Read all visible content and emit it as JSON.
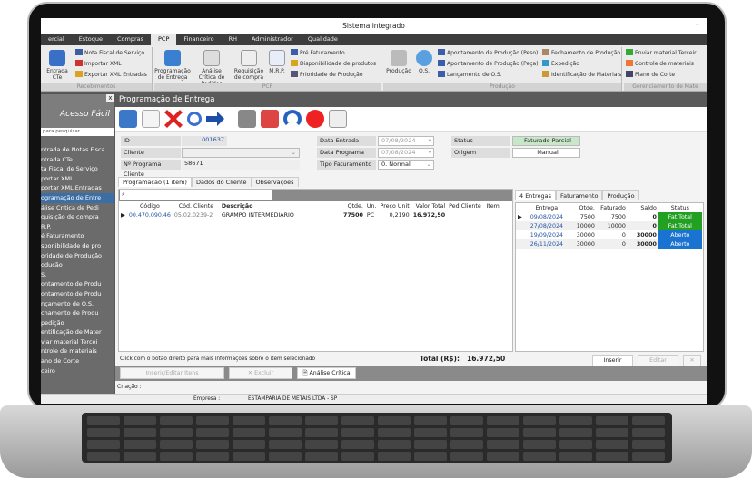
{
  "window_title": "Sistema integrado",
  "menu": [
    "ercial",
    "Estoque",
    "Compras",
    "PCP",
    "Financeiro",
    "RH",
    "Administrador",
    "Qualidade"
  ],
  "menu_active": "PCP",
  "ribbon": {
    "recebimentos": {
      "label": "Recebimentos",
      "big": "Entrada CTe",
      "items": [
        "Nota Fiscal de Serviço",
        "Importar XML",
        "Exportar XML Entradas"
      ]
    },
    "pcp": {
      "label": "PCP",
      "big": [
        "Programação de Entrega",
        "Análise Crítica de Pedidos",
        "Requisição de compra",
        "M.R.P."
      ],
      "items": [
        "Pré Faturamento",
        "Disponibilidade de produtos",
        "Prioridade de Produção"
      ]
    },
    "producao": {
      "label": "Produção",
      "big": [
        "Produção",
        "O.S."
      ],
      "items": [
        "Apontamento de Produção (Peso)",
        "Apontamento de Produção (Peça)",
        "Lançamento de O.S.",
        "Fechamento de Produção",
        "Expedição",
        "Identificação de Materiais"
      ]
    },
    "materiais": {
      "label": "Gerenciamento de Mate",
      "items": [
        "Enviar material Terceir",
        "Controle de materiais",
        "Plano de Corte"
      ]
    }
  },
  "left_panel": {
    "title": "Acesso Fácil",
    "search_placeholder": "para pesquisar",
    "items": [
      "ntrada de Notas Fisca",
      "ntrada CTe",
      "ta Fiscal de Serviço",
      "portar XML",
      "portar XML Entradas",
      "ogramação de Entre",
      "álise Crítica de Pedi",
      "quisição de compra",
      "R.P.",
      "é Faturamento",
      "sponibilidade de pro",
      "oridade de Produção",
      "odução",
      "S.",
      "ontamento de Produ",
      "ontamento de Produ",
      "nçamento de O.S.",
      "chamento de Produ",
      "pedição",
      "entificação de Mater",
      "viar material Tercei",
      "ntrole de materiais",
      "ano de Corte",
      "ceiro"
    ],
    "selected": 5
  },
  "form": {
    "title": "Programação de Entrega",
    "id_label": "ID",
    "id": "001637",
    "cliente_label": "Cliente",
    "cliente": "",
    "nprog_label": "Nº Programa Cliente",
    "nprog": "58671",
    "data_entrada_label": "Data Entrada",
    "data_entrada": "07/08/2024",
    "data_programa_label": "Data Programa",
    "data_programa": "07/08/2024",
    "tipo_label": "Tipo Faturamento",
    "tipo": "0. Normal",
    "status_label": "Status",
    "status": "Faturado Parcial",
    "origem_label": "Origem",
    "origem": "Manual"
  },
  "tabs": [
    "Programação (1 item)",
    "Dados do Cliente",
    "Observações"
  ],
  "items_grid": {
    "columns": [
      "Código",
      "Cód. Cliente",
      "Descrição",
      "Qtde.",
      "Un.",
      "Preço Unit",
      "Valor Total",
      "Ped.Cliente",
      "Item"
    ],
    "rows": [
      [
        "00.470.090.46",
        "05.02.0239-2",
        "GRAMPO INTERMEDIARIO",
        "77500",
        "PC",
        "0,2190",
        "16.972,50",
        "",
        ""
      ]
    ]
  },
  "hint": "Click com o botão direito para mais informações sobre o item selecionado",
  "total_label": "Total (R$):",
  "total": "16.972,50",
  "entregas_tabs": [
    "4 Entregas",
    "Faturamento",
    "Produção"
  ],
  "entregas": {
    "columns": [
      "Entrega",
      "Qtde.",
      "Faturado",
      "Saldo",
      "Status"
    ],
    "rows": [
      [
        "09/08/2024",
        "7500",
        "7500",
        "0",
        "Fat.Total"
      ],
      [
        "27/08/2024",
        "10000",
        "10000",
        "0",
        "Fat.Total"
      ],
      [
        "19/09/2024",
        "30000",
        "0",
        "30000",
        "Aberto"
      ],
      [
        "26/11/2024",
        "30000",
        "0",
        "30000",
        "Aberto"
      ]
    ]
  },
  "buttons": {
    "inserir": "Inserir",
    "editar": "Editar",
    "inserir_editar": "Inserir/Editar Itens",
    "excluir": "Excluir",
    "analise": "Análise Crítica"
  },
  "criacao": "Criação :",
  "empresa_label": "Empresa :",
  "empresa": "ESTAMPARIA DE METAIS LTDA - SP",
  "colors": {
    "fat_total": "#22a022",
    "aberto": "#1a73d0",
    "status_bg": "#c8e6c8"
  }
}
